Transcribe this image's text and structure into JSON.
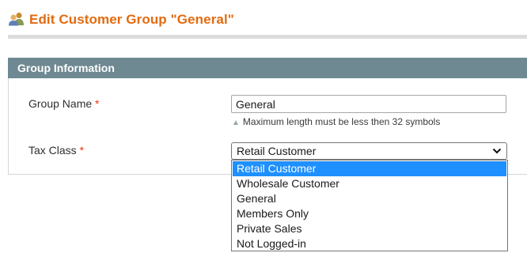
{
  "header": {
    "title": "Edit Customer Group \"General\"",
    "icon": "customer-group-icon"
  },
  "section": {
    "title": "Group Information"
  },
  "form": {
    "group_name": {
      "label": "Group Name",
      "required_mark": "*",
      "value": "General",
      "note": "Maximum length must be less then 32 symbols"
    },
    "tax_class": {
      "label": "Tax Class",
      "required_mark": "*",
      "selected": "Retail Customer",
      "options": [
        "Retail Customer",
        "Wholesale Customer",
        "General",
        "Members Only",
        "Private Sales",
        "Not Logged-in"
      ],
      "highlighted_index": 0
    }
  },
  "colors": {
    "title": "#e26b10",
    "section_header": "#6f8992",
    "required": "#eb340a",
    "option_highlight": "#1e90ff"
  }
}
